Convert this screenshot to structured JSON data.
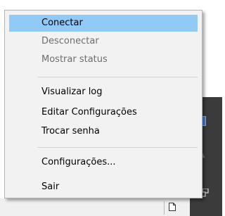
{
  "menu": {
    "items": [
      {
        "label": "Conectar",
        "state": "selected"
      },
      {
        "label": "Desconectar",
        "state": "disabled"
      },
      {
        "label": "Mostrar status",
        "state": "disabled"
      },
      {
        "label": "Visualizar log",
        "state": "normal"
      },
      {
        "label": "Editar Configurações",
        "state": "normal"
      },
      {
        "label": "Trocar senha",
        "state": "normal"
      },
      {
        "label": "Configurações...",
        "state": "normal"
      },
      {
        "label": "Sair",
        "state": "normal"
      }
    ]
  },
  "colors": {
    "highlight": "#91c9f7",
    "menu_background": "#f2f2f2",
    "disabled_text": "#6d6d6d",
    "taskbar": "#3b3b3b"
  },
  "icons": {
    "tray": [
      "app-tray-icon",
      "hidden-tray-icon",
      "network-icon"
    ],
    "strip": [
      "document-icon"
    ]
  }
}
